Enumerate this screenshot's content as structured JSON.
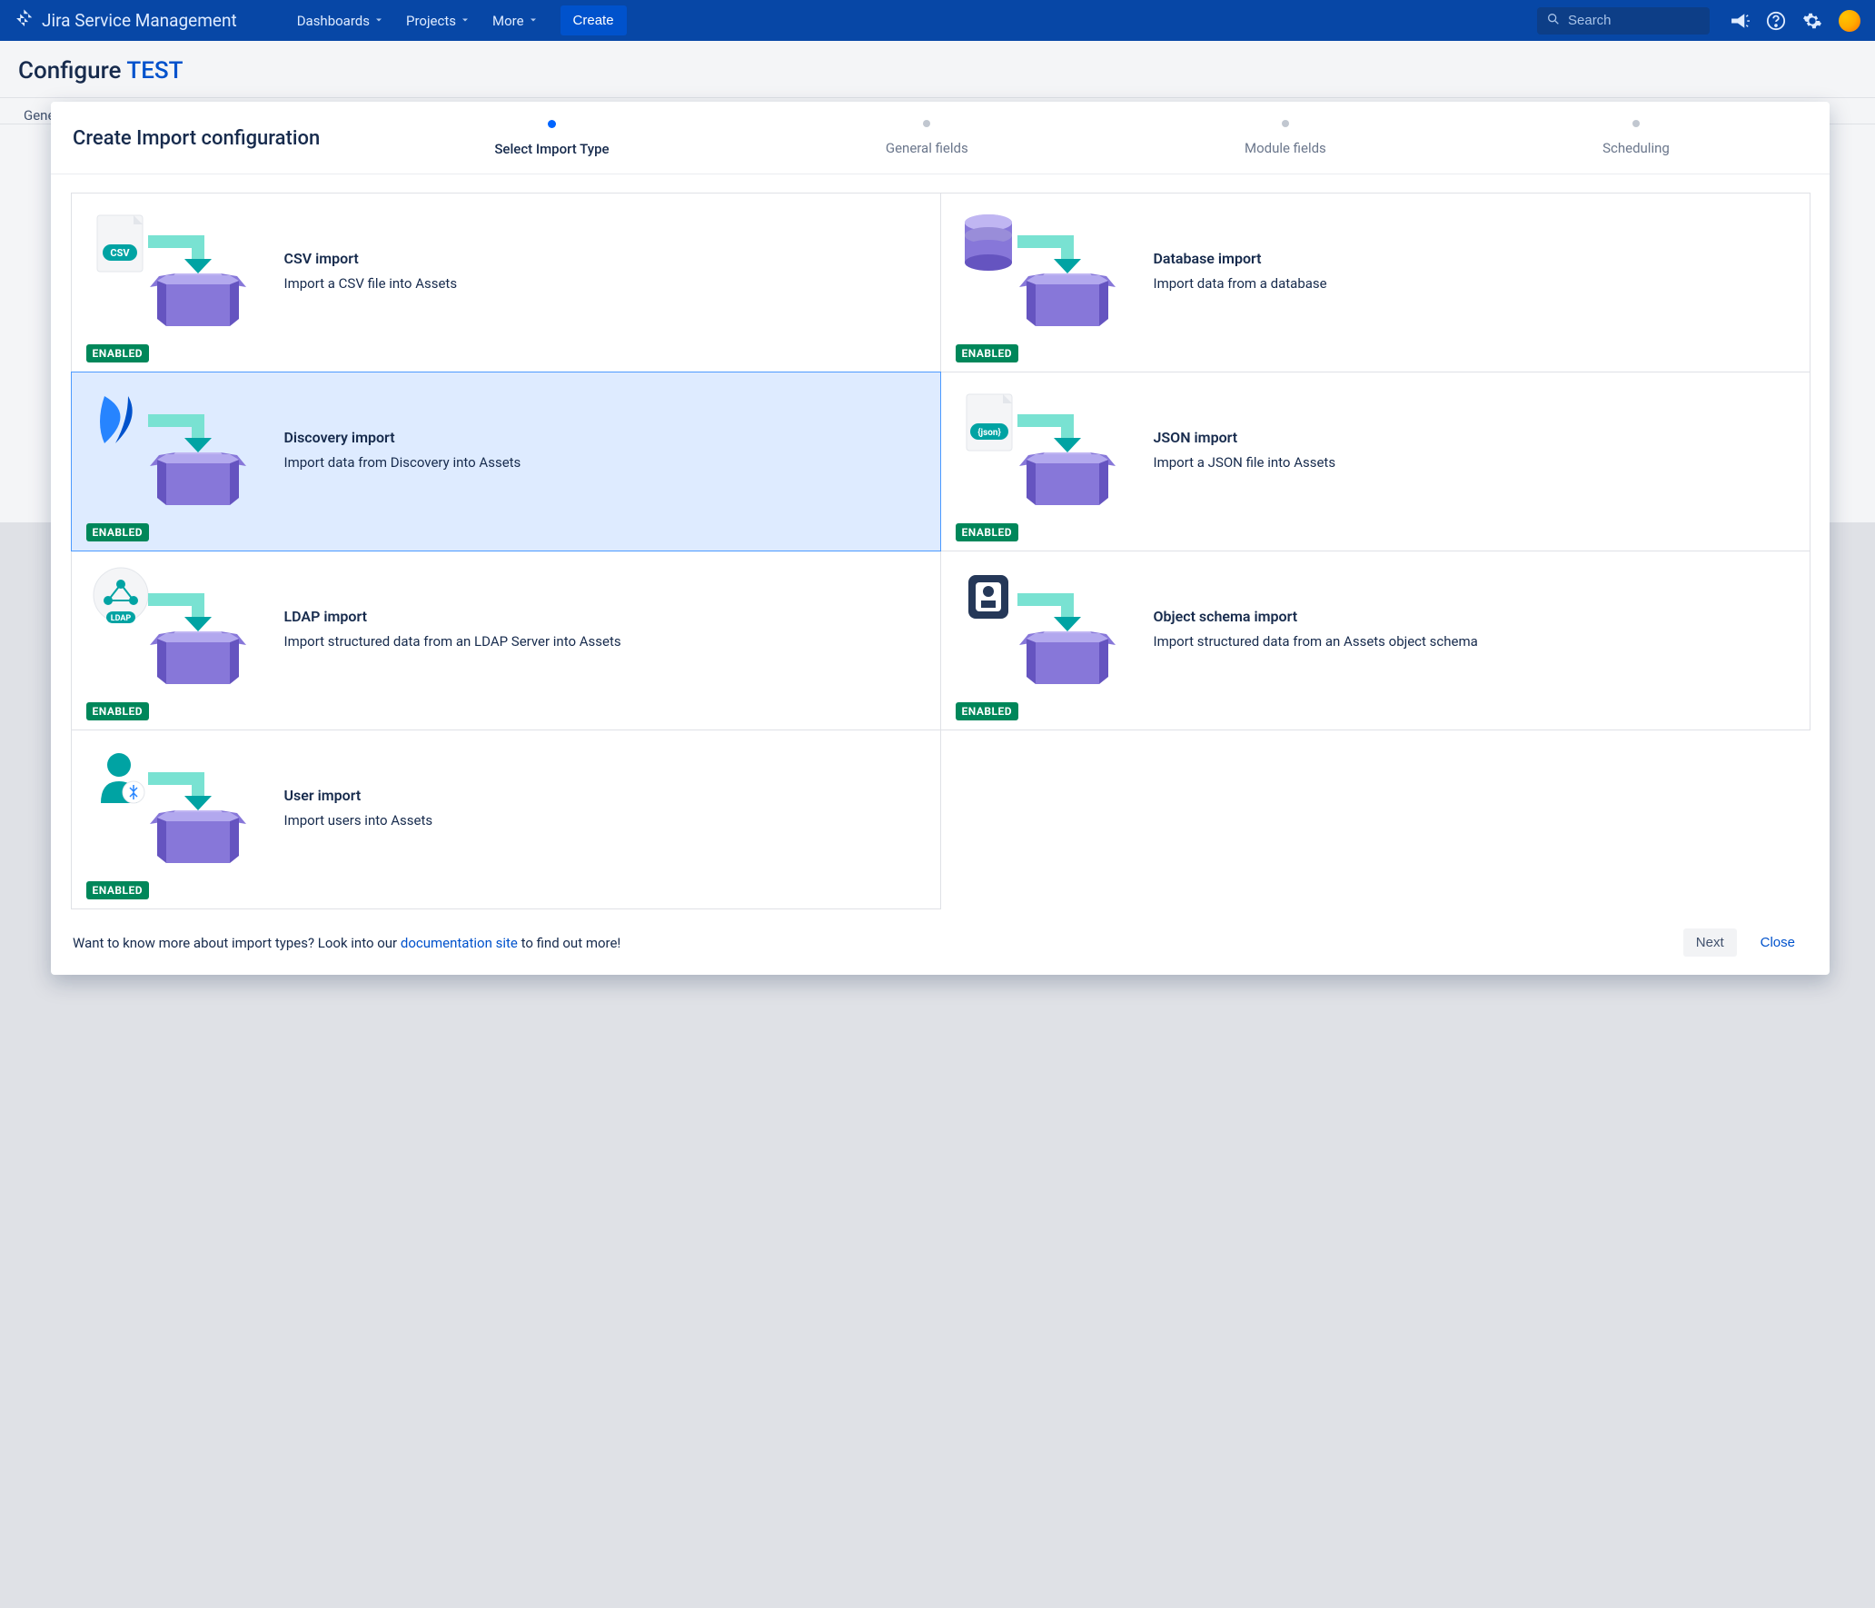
{
  "nav": {
    "brand": "Jira Service Management",
    "items": [
      "Dashboards",
      "Projects",
      "More"
    ],
    "create": "Create",
    "search_placeholder": "Search"
  },
  "page": {
    "title_prefix": "Configure ",
    "title_key": "TEST",
    "tab_label": "General"
  },
  "modal": {
    "title": "Create Import configuration",
    "steps": [
      "Select Import Type",
      "General fields",
      "Module fields",
      "Scheduling"
    ],
    "active_step": 0,
    "cards": [
      {
        "title": "CSV import",
        "desc": "Import a CSV file into Assets",
        "badge": "ENABLED",
        "icon": "csv"
      },
      {
        "title": "Database import",
        "desc": "Import data from a database",
        "badge": "ENABLED",
        "icon": "db"
      },
      {
        "title": "Discovery import",
        "desc": "Import data from Discovery into Assets",
        "badge": "ENABLED",
        "selected": true,
        "icon": "discovery"
      },
      {
        "title": "JSON import",
        "desc": "Import a JSON file into Assets",
        "badge": "ENABLED",
        "icon": "json"
      },
      {
        "title": "LDAP import",
        "desc": "Import structured data from an LDAP Server into Assets",
        "badge": "ENABLED",
        "icon": "ldap"
      },
      {
        "title": "Object schema import",
        "desc": "Import structured data from an Assets object schema",
        "badge": "ENABLED",
        "icon": "schema"
      },
      {
        "title": "User import",
        "desc": "Import users into Assets",
        "badge": "ENABLED",
        "icon": "user"
      }
    ],
    "footer": {
      "text_before": "Want to know more about import types? Look into our ",
      "link": "documentation site",
      "text_after": " to find out more!",
      "next": "Next",
      "close": "Close"
    }
  }
}
